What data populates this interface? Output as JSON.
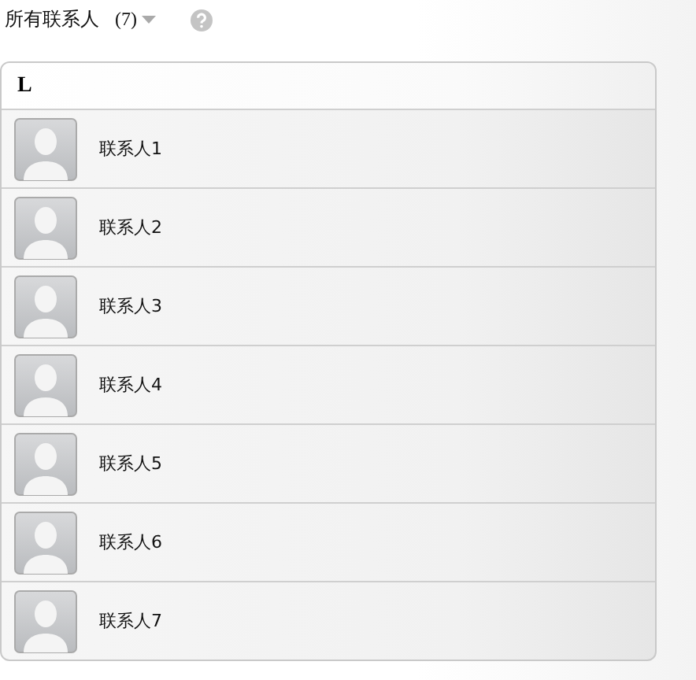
{
  "header": {
    "title": "所有联系人",
    "count": "(7)"
  },
  "section": {
    "letter": "L"
  },
  "contacts": [
    {
      "name": "联系人1"
    },
    {
      "name": "联系人2"
    },
    {
      "name": "联系人3"
    },
    {
      "name": "联系人4"
    },
    {
      "name": "联系人5"
    },
    {
      "name": "联系人6"
    },
    {
      "name": "联系人7"
    }
  ]
}
